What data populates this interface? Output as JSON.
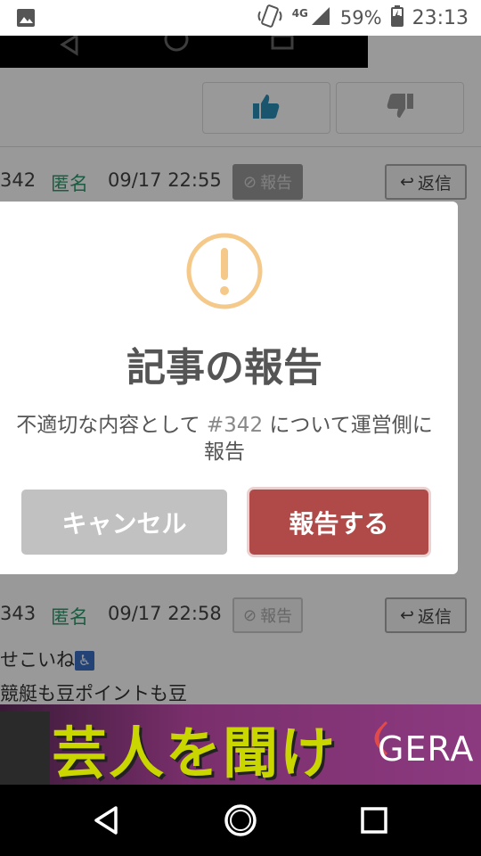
{
  "status_bar": {
    "signal_label": "4G",
    "battery": "59%",
    "time": "23:13"
  },
  "comments": [
    {
      "num": "342",
      "author": "匿名",
      "date": "09/17 22:55",
      "report_label": "報告",
      "reply_label": "返信"
    },
    {
      "num": "343",
      "author": "匿名",
      "date": "09/17 22:58",
      "report_label": "報告",
      "reply_label": "返信",
      "lines": [
        "せこいね",
        "競艇も豆ポイントも豆"
      ]
    }
  ],
  "modal": {
    "title": "記事の報告",
    "text_before": "不適切な内容として",
    "ref": "#342",
    "text_after": "について運営側に報告",
    "cancel_label": "キャンセル",
    "confirm_label": "報告する"
  },
  "ad": {
    "headline": "芸人を聞け",
    "brand": "GERA"
  },
  "colors": {
    "anon_green": "#2f9a6e",
    "confirm_red": "#b04a48",
    "warn_orange": "#f5c98a",
    "like_blue": "#2a8fb8"
  }
}
